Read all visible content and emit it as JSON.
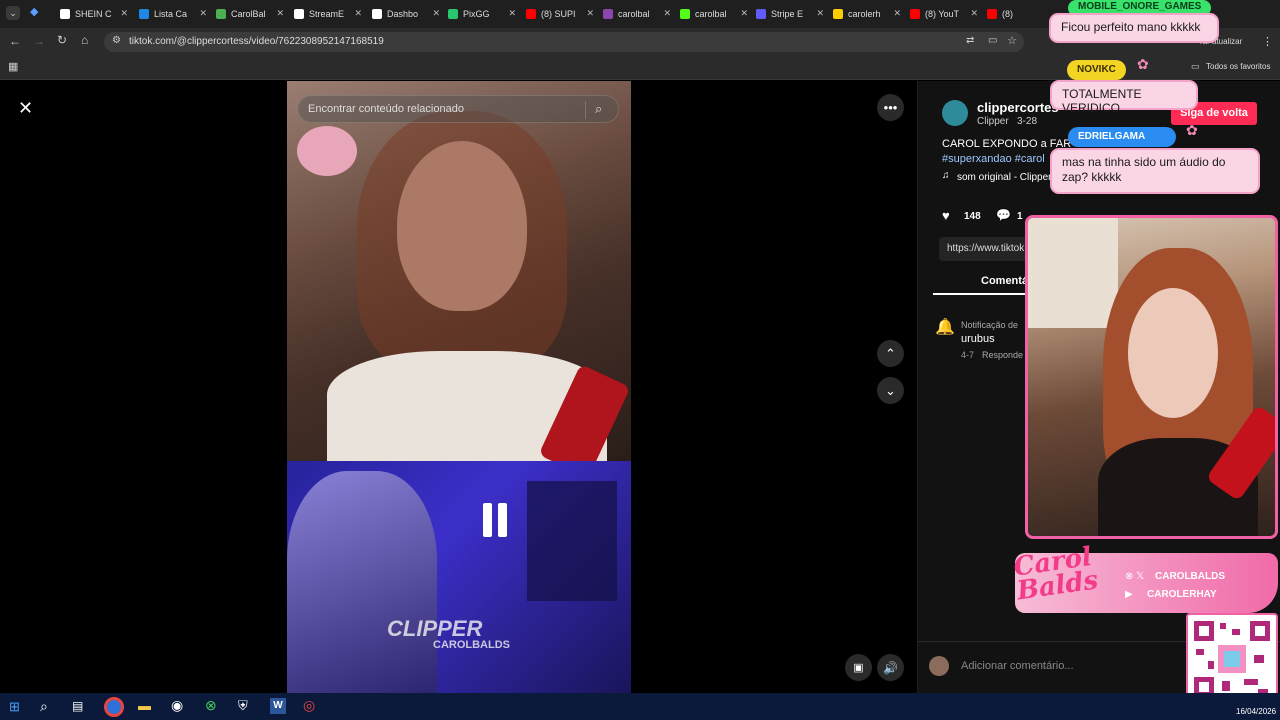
{
  "browser": {
    "tabs": [
      "SHEIN C",
      "Lista Ca",
      "CarolBal",
      "StreamE",
      "Dashbo",
      "PixGG",
      "(8) SUPI",
      "carolbal",
      "carolbal",
      "Stripe E",
      "carolerh",
      "(8) YouT",
      "(8)"
    ],
    "url": "tiktok.com/@clippercortess/video/7622308952147168519",
    "update_label": "rar atualizar",
    "favorites_label": "Todos os favoritos"
  },
  "video": {
    "search_placeholder": "Encontrar conteúdo relacionado",
    "watermark_brand": "CLIPPER",
    "watermark_sub": "CAROLBALDS"
  },
  "post": {
    "username": "clippercortes",
    "display_name": "Clipper",
    "date": "3-28",
    "follow_label": "Siga de volta",
    "caption": "CAROL EXPONDO a FAR",
    "hashtags": "#superxandao #carol",
    "sound": "som original - Clipper",
    "likes": "148",
    "comments": "1",
    "link": "https://www.tiktok",
    "comments_tab": "Comentá",
    "notification_label": "Notificação de",
    "comment_text": "urubus",
    "comment_date": "4-7",
    "reply_label": "Responde",
    "add_comment_placeholder": "Adicionar comentário..."
  },
  "overlay": {
    "chat": [
      {
        "user": "MOBILE_ONORE_GAMES",
        "message": "Ficou perfeito mano kkkkk",
        "color": "#39e36b"
      },
      {
        "user": "NOVIKC",
        "message": "TOTALMENTE VERIDICO",
        "color": "#f2d423"
      },
      {
        "user": "EDRIELGAMA",
        "message": "mas na tinha sido um áudio do zap? kkkkk",
        "color": "#2a8cf0"
      }
    ],
    "logo_text": "Carol Balds",
    "social_x": "CAROLBALDS",
    "social_yt": "CAROLERHAY"
  },
  "taskbar": {
    "date": "16/04/2026"
  }
}
